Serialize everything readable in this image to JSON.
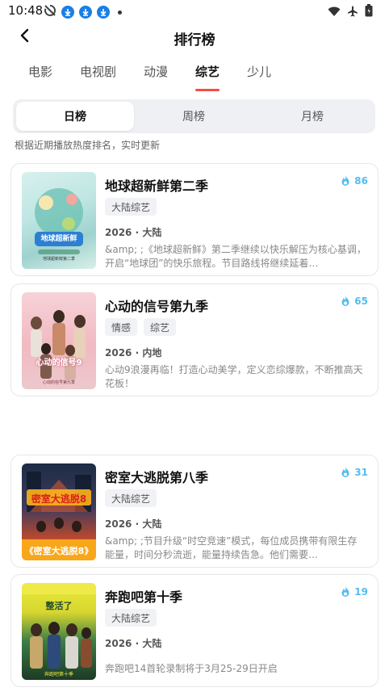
{
  "status_bar": {
    "time": "10:48",
    "left_icons": [
      "sync-off-icon",
      "download-icon",
      "download-icon",
      "download-icon",
      "notification-dot-icon"
    ],
    "right_icons": [
      "wifi-icon",
      "airplane-icon",
      "battery-icon"
    ]
  },
  "header": {
    "title": "排行榜",
    "back_icon": "chevron-left-icon"
  },
  "tabs": [
    {
      "label": "电影",
      "active": false
    },
    {
      "label": "电视剧",
      "active": false
    },
    {
      "label": "动漫",
      "active": false
    },
    {
      "label": "综艺",
      "active": true
    },
    {
      "label": "少儿",
      "active": false
    }
  ],
  "segment": [
    {
      "label": "日榜",
      "active": true
    },
    {
      "label": "周榜",
      "active": false
    },
    {
      "label": "月榜",
      "active": false
    }
  ],
  "hint": "根据近期播放热度排名，实时更新",
  "colors": {
    "accent": "#f24e47",
    "heat": "#53bdf0",
    "tag_bg": "#f1f2f5"
  },
  "items": [
    {
      "title": "地球超新鲜第二季",
      "heat": "86",
      "tags": [
        "大陆综艺"
      ],
      "meta": "2026 · 大陆",
      "desc": "&amp; ;《地球超新鲜》第二季继续以快乐解压为核心基调，开启“地球团”的快乐旅程。节目路线将继续延着…",
      "poster_title": "地球超新鲜",
      "poster_sub": "地球超新鲜第二季"
    },
    {
      "title": "心动的信号第九季",
      "heat": "65",
      "tags": [
        "情感",
        "综艺"
      ],
      "meta": "2026 · 内地",
      "desc": "心动9浪漫再临！打造心动美学，定义恋综爆款，不断推高天花板！",
      "poster_title": "心动的信号9",
      "poster_sub": "心动的信号第九季"
    },
    {
      "title": "密室大逃脱第八季",
      "heat": "31",
      "tags": [
        "大陆综艺"
      ],
      "meta": "2026 · 大陆",
      "desc": "&amp; ;节目升级“时空竞速”模式，每位成员携带有限生存能量，时间分秒流逝，能量持续告急。他们需要…",
      "poster_title": "密室大逃脱8",
      "poster_sub": "《密室大逃脱8》"
    },
    {
      "title": "奔跑吧第十季",
      "heat": "19",
      "tags": [
        "大陆综艺"
      ],
      "meta": "2026 · 大陆",
      "desc": "奔跑吧14首轮录制将于3月25-29日开启",
      "poster_title": "整活了",
      "poster_sub": "奔跑吧第十季"
    }
  ]
}
